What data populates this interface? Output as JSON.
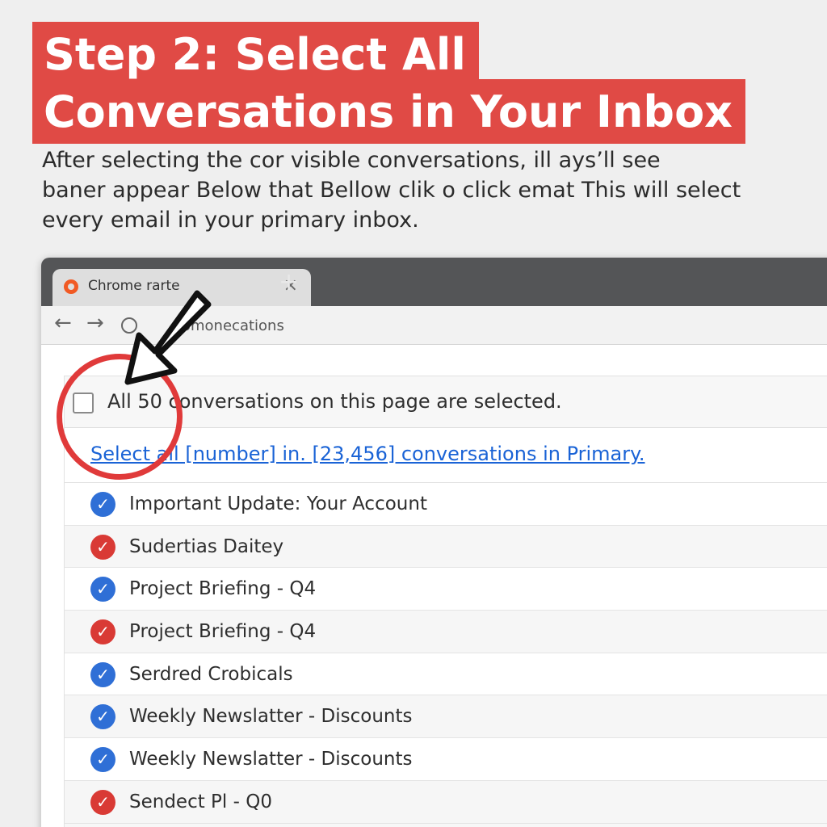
{
  "heading": {
    "line1": "Step 2: Select All",
    "line2": "Conversations in Your Inbox"
  },
  "intro": {
    "line1": "After selecting the cor visible conversations, ill ays’ll see",
    "line2": "baner appear  Below that Bellow clik  o click emat  This will select",
    "line3": "every email in your primary inbox."
  },
  "browser": {
    "tab_title": "Chrome rarte",
    "close_icon": "×",
    "new_tab_icon": "+",
    "back_icon": "←",
    "forward_icon": "→",
    "address": "omonecations"
  },
  "mail": {
    "selected_text": "All 50 conversations on this page are selected.",
    "select_all_link": "Select all [number] in. [23,456] conversations in Primary.",
    "conversations": [
      {
        "subject": "Important Update: Your Account",
        "color": "#2f6fd6"
      },
      {
        "subject": "Sudertias Daitey",
        "color": "#d93a35"
      },
      {
        "subject": "Project Briefing - Q4",
        "color": "#2f6fd6"
      },
      {
        "subject": "Project Briefing - Q4",
        "color": "#d93a35"
      },
      {
        "subject": "Serdred Crobicals",
        "color": "#2f6fd6"
      },
      {
        "subject": "Weekly Newslatter - Discounts",
        "color": "#2f6fd6"
      },
      {
        "subject": "Weekly Newslatter - Discounts",
        "color": "#2f6fd6"
      },
      {
        "subject": "Sendect Pl - Q0",
        "color": "#d93a35"
      }
    ]
  },
  "colors": {
    "heading_bg": "#e04a45",
    "link": "#1a63d6",
    "annotation": "#e03a3a"
  }
}
